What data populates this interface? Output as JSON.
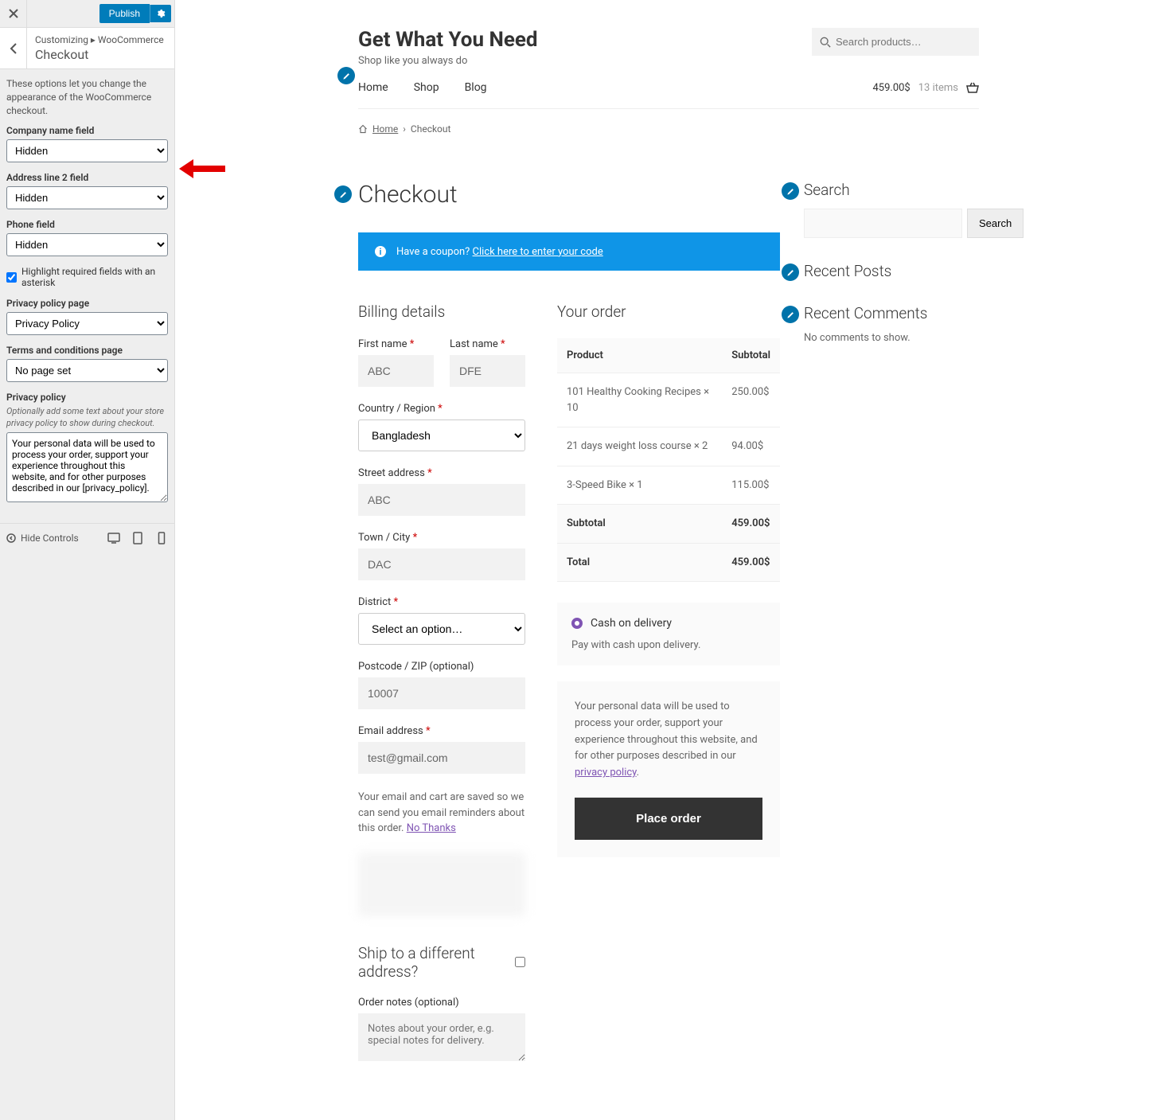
{
  "sidebar": {
    "publish_label": "Publish",
    "breadcrumb_top": "Customizing ▸ WooCommerce",
    "breadcrumb_title": "Checkout",
    "description": "These options let you change the appearance of the WooCommerce checkout.",
    "fields": {
      "company_label": "Company name field",
      "company_value": "Hidden",
      "address2_label": "Address line 2 field",
      "address2_value": "Hidden",
      "phone_label": "Phone field",
      "phone_value": "Hidden",
      "highlight_label": "Highlight required fields with an asterisk",
      "privacy_page_label": "Privacy policy page",
      "privacy_page_value": "Privacy Policy",
      "terms_label": "Terms and conditions page",
      "terms_value": "No page set",
      "privacy_label": "Privacy policy",
      "privacy_note": "Optionally add some text about your store privacy policy to show during checkout.",
      "privacy_text": "Your personal data will be used to process your order, support your experience throughout this website, and for other purposes described in our [privacy_policy]."
    },
    "hide_controls": "Hide Controls"
  },
  "site": {
    "title": "Get What You Need",
    "tagline": "Shop like you always do",
    "search_placeholder": "Search products…",
    "nav": [
      "Home",
      "Shop",
      "Blog"
    ],
    "cart_price": "459.00$",
    "cart_items": "13 items"
  },
  "crumbs": {
    "home": "Home",
    "current": "Checkout"
  },
  "page": {
    "title": "Checkout",
    "coupon_text": "Have a coupon? ",
    "coupon_link": "Click here to enter your code"
  },
  "billing": {
    "heading": "Billing details",
    "first_name_label": "First name ",
    "first_name_value": "ABC",
    "last_name_label": "Last name ",
    "last_name_value": "DFE",
    "country_label": "Country / Region ",
    "country_value": "Bangladesh",
    "street_label": "Street address ",
    "street_value": "ABC",
    "town_label": "Town / City ",
    "town_value": "DAC",
    "district_label": "District ",
    "district_value": "Select an option…",
    "postcode_label": "Postcode / ZIP (optional)",
    "postcode_value": "10007",
    "email_label": "Email address ",
    "email_value": "test@gmail.com",
    "email_note_pre": "Your email and cart are saved so we can send you email reminders about this order. ",
    "email_note_link": "No Thanks",
    "ship_heading": "Ship to a different address?",
    "notes_label": "Order notes (optional)",
    "notes_placeholder": "Notes about your order, e.g. special notes for delivery."
  },
  "order": {
    "heading": "Your order",
    "th_product": "Product",
    "th_subtotal": "Subtotal",
    "items": [
      {
        "name": "101 Healthy Cooking Recipes  × 10",
        "price": "250.00$"
      },
      {
        "name": "21 days weight loss course  × 2",
        "price": "94.00$"
      },
      {
        "name": "3-Speed Bike  × 1",
        "price": "115.00$"
      }
    ],
    "subtotal_label": "Subtotal",
    "subtotal_value": "459.00$",
    "total_label": "Total",
    "total_value": "459.00$",
    "pay_method": "Cash on delivery",
    "pay_desc": "Pay with cash upon delivery.",
    "privacy_text_pre": "Your personal data will be used to process your order, support your experience throughout this website, and for other purposes described in our ",
    "privacy_link": "privacy policy",
    "place_order": "Place order"
  },
  "widgets": {
    "search_label": "Search",
    "search_btn": "Search",
    "recent_posts": "Recent Posts",
    "recent_comments": "Recent Comments",
    "no_comments": "No comments to show."
  }
}
